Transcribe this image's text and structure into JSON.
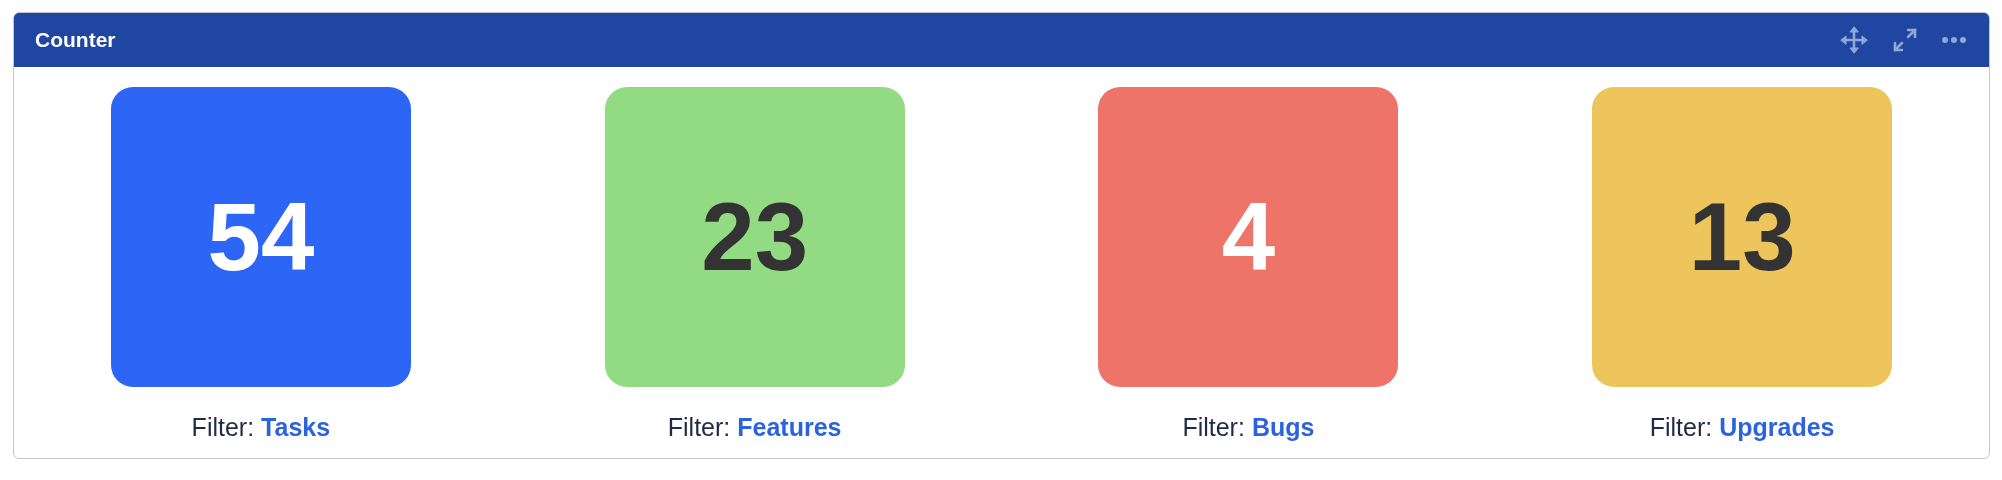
{
  "panel": {
    "title": "Counter"
  },
  "counters": [
    {
      "value": "54",
      "color": "#2d66f6",
      "dark_text": false,
      "filter_label": "Filter:",
      "filter": "Tasks"
    },
    {
      "value": "23",
      "color": "#93db83",
      "dark_text": true,
      "filter_label": "Filter:",
      "filter": "Features"
    },
    {
      "value": "4",
      "color": "#ee7368",
      "dark_text": false,
      "filter_label": "Filter:",
      "filter": "Bugs"
    },
    {
      "value": "13",
      "color": "#eec55c",
      "dark_text": true,
      "filter_label": "Filter:",
      "filter": "Upgrades"
    }
  ]
}
